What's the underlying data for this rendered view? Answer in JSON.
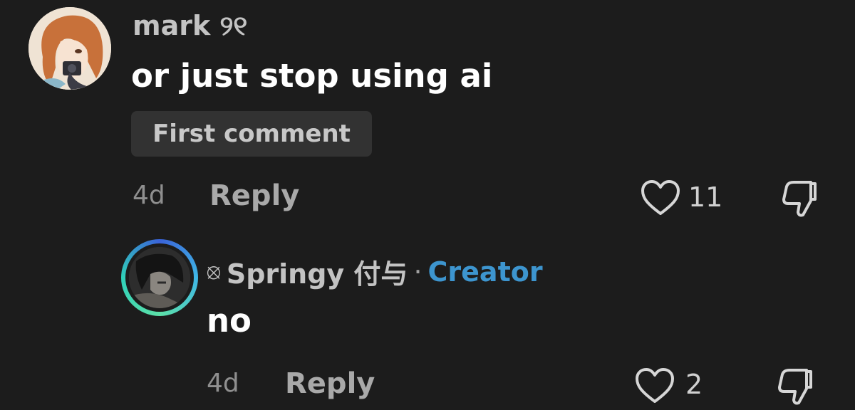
{
  "comments": [
    {
      "username": "mark ୨୧",
      "text": "or just stop using ai",
      "badge": "First comment",
      "age": "4d",
      "reply_label": "Reply",
      "like_count": "11",
      "avatar_icon": "anime-girl-avatar"
    },
    {
      "username_prefix_icon": "⦻",
      "username": "Springy 付与",
      "separator": "·",
      "role": "Creator",
      "text": "no",
      "age": "4d",
      "reply_label": "Reply",
      "like_count": "2",
      "avatar_icon": "dark-character-avatar"
    }
  ],
  "colors": {
    "background": "#1c1c1c",
    "creator_accent": "#3d95cf",
    "badge_bg": "#323232"
  }
}
